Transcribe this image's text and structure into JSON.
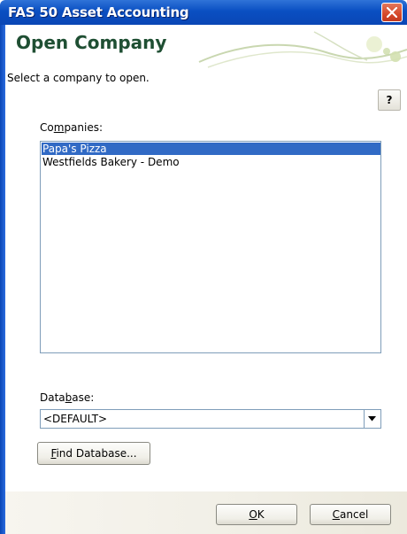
{
  "window": {
    "title": "FAS 50 Asset Accounting",
    "close_icon": "close-icon"
  },
  "header": {
    "title": "Open Company",
    "subtitle": "Select a company to open.",
    "help_label": "?"
  },
  "companies": {
    "label_pre": "Co",
    "label_mn": "m",
    "label_post": "panies:",
    "items": [
      {
        "name": "Papa's Pizza",
        "selected": true
      },
      {
        "name": "Westfields Bakery - Demo",
        "selected": false
      }
    ]
  },
  "database": {
    "label_pre": "Data",
    "label_mn": "b",
    "label_post": "ase:",
    "value": "<DEFAULT>",
    "find_label_mn": "F",
    "find_label_post": "ind Database..."
  },
  "footer": {
    "ok_mn": "O",
    "ok_post": "K",
    "cancel_mn": "C",
    "cancel_post": "ancel"
  },
  "colors": {
    "title_bar": "#0a4fc2",
    "header_title": "#1f4f33",
    "selection": "#316ac5"
  }
}
